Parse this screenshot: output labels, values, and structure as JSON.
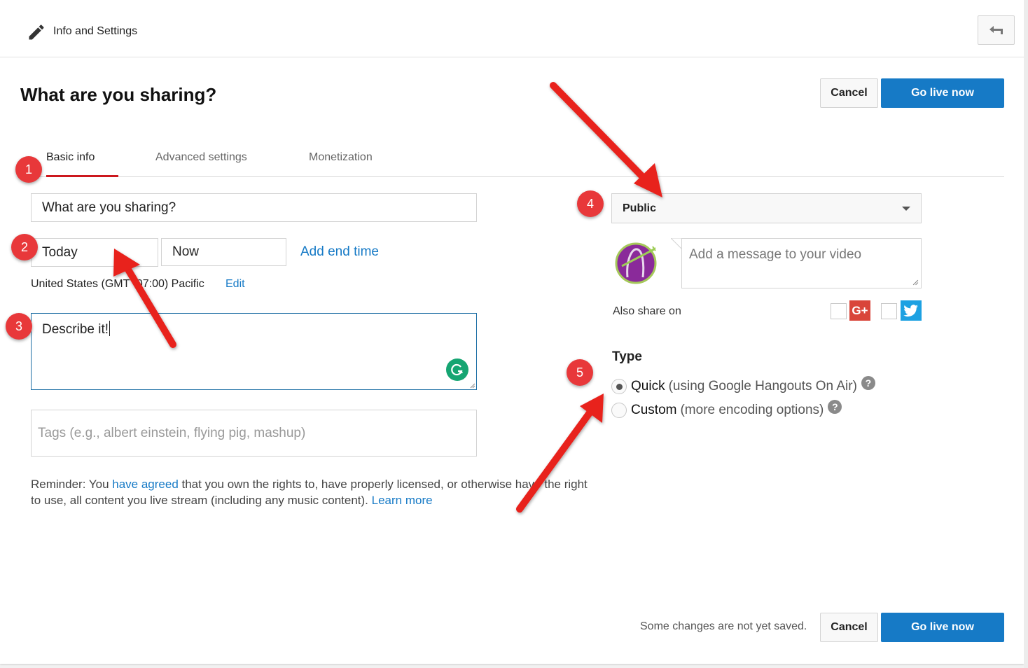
{
  "topbar": {
    "title": "Info and Settings",
    "icon": "pencil-icon",
    "back_icon": "back-arrow-icon"
  },
  "header": {
    "page_title": "What are you sharing?",
    "cancel_label": "Cancel",
    "go_live_label": "Go live now"
  },
  "tabs": [
    {
      "label": "Basic info",
      "active": true
    },
    {
      "label": "Advanced settings",
      "active": false
    },
    {
      "label": "Monetization",
      "active": false
    }
  ],
  "form": {
    "title_value": "What are you sharing?",
    "date_value": "Today",
    "time_value": "Now",
    "add_end_time": "Add end time",
    "timezone": "United States (GMT -07:00) Pacific",
    "timezone_edit": "Edit",
    "description_value": "Describe it!",
    "tags_placeholder": "Tags (e.g., albert einstein, flying pig, mashup)",
    "reminder": {
      "prefix": "Reminder: You ",
      "link1": "have agreed",
      "middle": " that you own the rights to, have properly licensed, or otherwise have the right to use, all content you live stream (including any music content). ",
      "link2": "Learn more"
    }
  },
  "sidebar": {
    "privacy_value": "Public",
    "message_placeholder": "Add a message to your video",
    "also_share_label": "Also share on",
    "share_targets": [
      {
        "name": "Google+",
        "glyph": "G+",
        "checked": false
      },
      {
        "name": "Twitter",
        "checked": false
      }
    ],
    "type_label": "Type",
    "type_options": [
      {
        "label": "Quick",
        "detail": "(using Google Hangouts On Air)",
        "selected": true
      },
      {
        "label": "Custom",
        "detail": "(more encoding options)",
        "selected": false
      }
    ],
    "help_glyph": "?"
  },
  "footer": {
    "unsaved": "Some changes are not yet saved.",
    "cancel_label": "Cancel",
    "go_live_label": "Go live now"
  },
  "annotations": {
    "badges": [
      "1",
      "2",
      "3",
      "4",
      "5"
    ],
    "color": "#e8383a"
  },
  "colors": {
    "accent_blue": "#167ac6",
    "tab_active": "#cc181e",
    "grammarly": "#15a572",
    "gplus": "#d9453a",
    "twitter": "#1da1e2"
  }
}
